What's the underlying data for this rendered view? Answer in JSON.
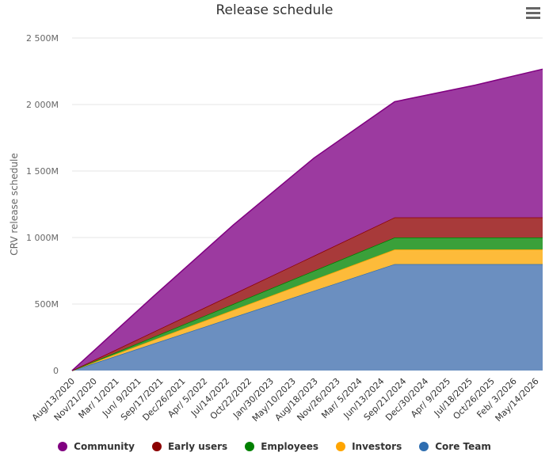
{
  "chart_data": {
    "type": "area",
    "stacked": true,
    "title": "Release schedule",
    "xlabel": "",
    "ylabel": "CRV release schedule",
    "ylim": [
      0,
      2500
    ],
    "y_unit_suffix": "M",
    "y_ticks": [
      "0",
      "500M",
      "1 000M",
      "1 500M",
      "2 000M",
      "2 500M"
    ],
    "y_tick_values": [
      0,
      500,
      1000,
      1500,
      2000,
      2500
    ],
    "x_ticks": [
      "Aug/13/2020",
      "Nov/21/2020",
      "Mar/ 1/2021",
      "Jun/ 9/2021",
      "Sep/17/2021",
      "Dec/26/2021",
      "Apr/ 5/2022",
      "Jul/14/2022",
      "Oct/22/2022",
      "Jan/30/2023",
      "May/10/2023",
      "Aug/18/2023",
      "Nov/26/2023",
      "Mar/ 5/2024",
      "Jun/13/2024",
      "Sep/21/2024",
      "Dec/30/2024",
      "Apr/ 9/2025",
      "Jul/18/2025",
      "Oct/26/2025",
      "Feb/ 3/2026",
      "May/14/2026"
    ],
    "x_days_range": [
      0,
      2130
    ],
    "x_days": [
      0,
      365,
      730,
      1095,
      1460,
      1825,
      2130
    ],
    "grid": true,
    "legend_position": "bottom",
    "series": [
      {
        "name": "Core Team",
        "color": "#2f6eb0",
        "fill": "#6b8fc0",
        "values": [
          0,
          200,
          400,
          600,
          800,
          800,
          800
        ]
      },
      {
        "name": "Investors",
        "color": "#ffa500",
        "fill": "#fdbb3a",
        "values": [
          0,
          28,
          55,
          83,
          110,
          110,
          110
        ]
      },
      {
        "name": "Employees",
        "color": "#008000",
        "fill": "#3aa03a",
        "values": [
          0,
          22,
          45,
          67,
          90,
          90,
          90
        ]
      },
      {
        "name": "Early users",
        "color": "#8b0000",
        "fill": "#a83a3a",
        "values": [
          0,
          38,
          75,
          113,
          151,
          151,
          151
        ]
      },
      {
        "name": "Community",
        "color": "#800080",
        "fill": "#9c3aa0",
        "values": [
          0,
          265,
          520,
          735,
          870,
          995,
          1115
        ]
      }
    ]
  },
  "menu": {
    "icon": "hamburger-icon"
  },
  "legend": [
    {
      "label": "Community",
      "color": "#800080"
    },
    {
      "label": "Early users",
      "color": "#8b0000"
    },
    {
      "label": "Employees",
      "color": "#008000"
    },
    {
      "label": "Investors",
      "color": "#ffa500"
    },
    {
      "label": "Core Team",
      "color": "#2f6eb0"
    }
  ]
}
